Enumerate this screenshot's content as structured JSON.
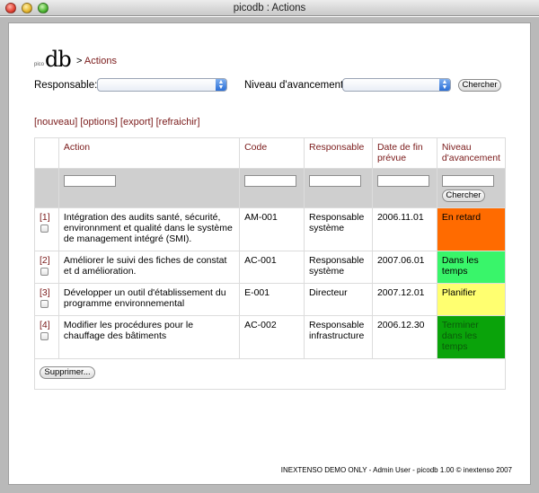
{
  "window": {
    "title": "picodb : Actions"
  },
  "header": {
    "logo_small": "pico",
    "logo_big": "db",
    "crumb_sep": ">",
    "crumb_current": "Actions"
  },
  "filters": {
    "responsable_label": "Responsable:",
    "responsable_value": "",
    "niveau_label": "Niveau d'avancement:",
    "niveau_value": "",
    "search_button": "Chercher"
  },
  "links": [
    "[nouveau]",
    "[options]",
    "[export]",
    "[refraichir]"
  ],
  "table": {
    "headers": [
      "Action",
      "Code",
      "Responsable",
      "Date de fin prévue",
      "Niveau d'avancement"
    ],
    "filter_button": "Chercher",
    "rows": [
      {
        "num": "[1]",
        "action": "Intégration des audits santé, sécurité, environnment et qualité dans le système de management intégré (SMI).",
        "code": "AM-001",
        "responsable": "Responsable système",
        "date": "2006.11.01",
        "niveau": "En retard",
        "color": "#ff6b00"
      },
      {
        "num": "[2]",
        "action": "Améliorer le suivi des fiches de constat et d amélioration.",
        "code": "AC-001",
        "responsable": "Responsable système",
        "date": "2007.06.01",
        "niveau": "Dans les temps",
        "color": "#39f56a"
      },
      {
        "num": "[3]",
        "action": "Développer un outil d'établissement du programme environnemental",
        "code": "E-001",
        "responsable": "Directeur",
        "date": "2007.12.01",
        "niveau": "Planifier",
        "color": "#ffff70"
      },
      {
        "num": "[4]",
        "action": "Modifier les procédures pour le chauffage des bâtiments",
        "code": "AC-002",
        "responsable": "Responsable infrastructure",
        "date": "2006.12.30",
        "niveau": "Terminer dans les temps",
        "color": "#0aa30a"
      }
    ],
    "delete_button": "Supprimer..."
  },
  "footer": {
    "text": "INEXTENSO DEMO ONLY - Admin User - picodb 1.00 © inextenso 2007"
  }
}
